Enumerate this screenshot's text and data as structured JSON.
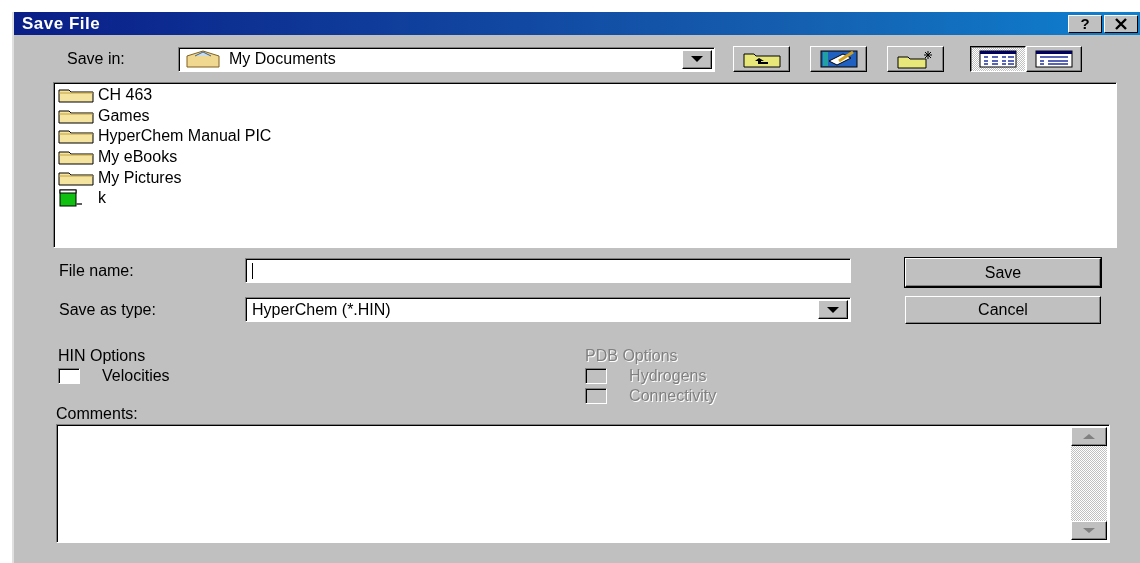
{
  "window": {
    "title": "Save File",
    "help": "?"
  },
  "save_in": {
    "label": "Save in:",
    "value": "My Documents"
  },
  "view_buttons": [
    {
      "kind": "list",
      "selected": true
    },
    {
      "kind": "details",
      "selected": false
    }
  ],
  "files": [
    {
      "name": "CH 463",
      "kind": "folder"
    },
    {
      "name": "Games",
      "kind": "folder"
    },
    {
      "name": "HyperChem Manual PIC",
      "kind": "folder"
    },
    {
      "name": "My eBooks",
      "kind": "folder"
    },
    {
      "name": "My Pictures",
      "kind": "folder"
    },
    {
      "name": "k",
      "kind": "document"
    }
  ],
  "file_name": {
    "label": "File name:"
  },
  "save_as_type": {
    "label": "Save as type:",
    "value": "HyperChem (*.HIN)"
  },
  "buttons": [
    {
      "label": "Save",
      "default": true
    },
    {
      "label": "Cancel",
      "default": false
    }
  ],
  "option_groups": [
    {
      "title": "HIN Options",
      "disabled": false,
      "options": [
        {
          "label": "Velocities",
          "checked": false
        }
      ]
    },
    {
      "title": "PDB Options",
      "disabled": true,
      "options": [
        {
          "label": "Hydrogens",
          "checked": false
        },
        {
          "label": "Connectivity",
          "checked": false
        }
      ]
    }
  ],
  "comments": {
    "label": "Comments:"
  }
}
